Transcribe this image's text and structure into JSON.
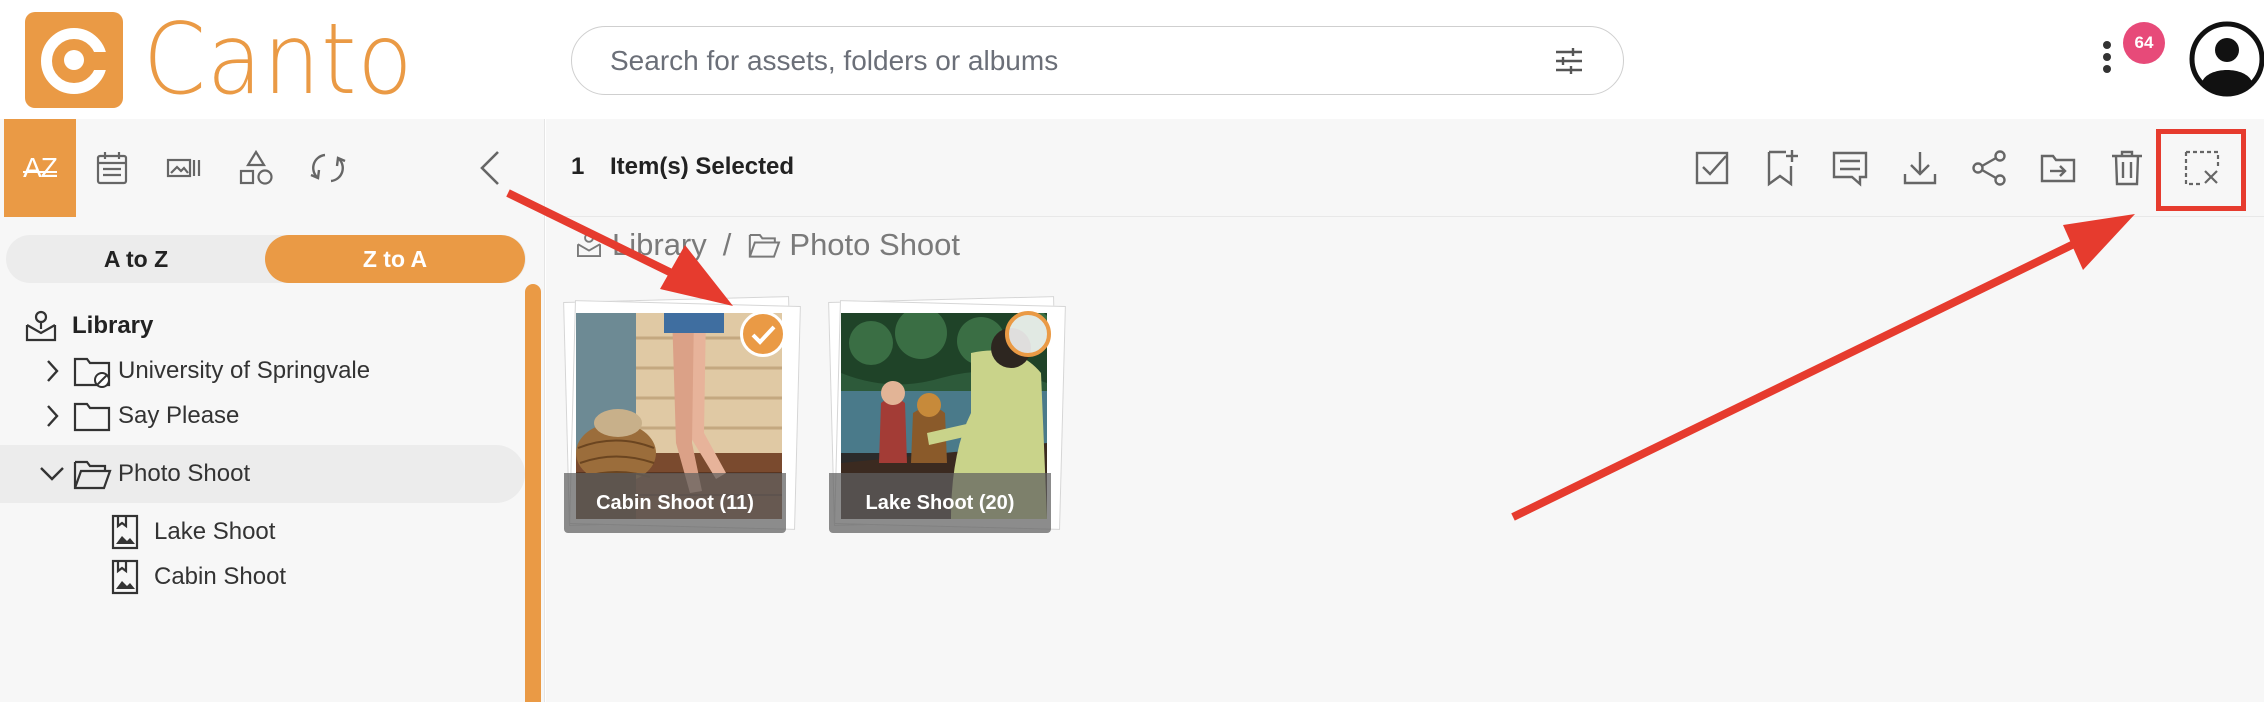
{
  "app": {
    "brand": "Canto"
  },
  "header": {
    "search_placeholder": "Search for assets, folders or albums",
    "notification_count": "64"
  },
  "sidebar": {
    "sort": {
      "a_to_z": "A to Z",
      "z_to_a": "Z to A",
      "active": "Z to A"
    },
    "tools": [
      "sort-az-icon",
      "calendar-icon",
      "gallery-icon",
      "shapes-icon",
      "sync-icon",
      "collapse-chevron-icon"
    ],
    "az_label": "AZ",
    "tree": [
      {
        "label": "Library",
        "level": 0,
        "type": "library"
      },
      {
        "label": "University of Springvale",
        "level": 1,
        "type": "folder-restricted",
        "expanded": false
      },
      {
        "label": "Say Please",
        "level": 1,
        "type": "folder",
        "expanded": false
      },
      {
        "label": "Photo Shoot",
        "level": 1,
        "type": "folder-open",
        "expanded": true,
        "selected": true
      },
      {
        "label": "Lake Shoot",
        "level": 2,
        "type": "album"
      },
      {
        "label": "Cabin Shoot",
        "level": 2,
        "type": "album"
      }
    ]
  },
  "main": {
    "selection": {
      "count": "1",
      "label": "Item(s) Selected"
    },
    "actions": [
      "select-all-icon",
      "bookmark-add-icon",
      "comment-icon",
      "download-icon",
      "share-icon",
      "move-icon",
      "delete-icon",
      "clear-selection-icon"
    ],
    "breadcrumb": {
      "root": "Library",
      "separator": "/",
      "current": "Photo Shoot"
    },
    "albums": [
      {
        "name": "Cabin Shoot (11)",
        "selected": true
      },
      {
        "name": "Lake Shoot (20)",
        "selected": false
      }
    ]
  },
  "colors": {
    "brand": "#ea9a45",
    "annotation": "#e63b2e",
    "badge": "#e74a79"
  }
}
